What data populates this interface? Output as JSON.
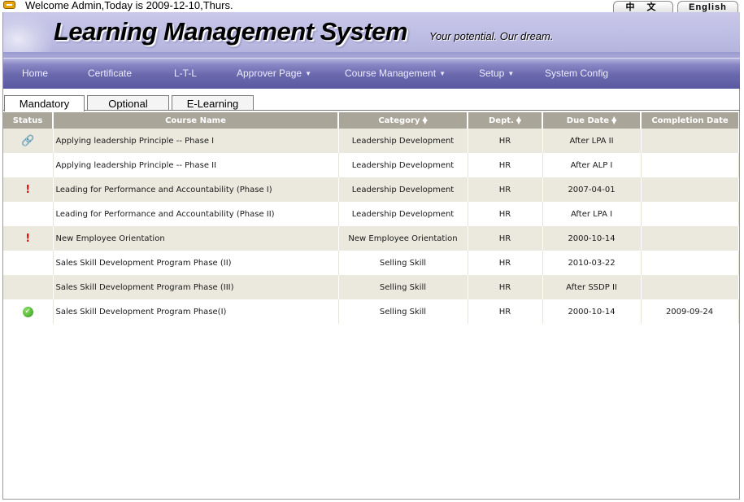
{
  "topbar": {
    "welcome_text": "Welcome Admin,Today is 2009-12-10,Thurs.",
    "lang_chinese": "中 文",
    "lang_english": "English"
  },
  "header": {
    "title": "Learning Management System",
    "tagline": "Your potential. Our dream."
  },
  "nav": {
    "items": [
      {
        "label": "Home",
        "has_dropdown": false
      },
      {
        "label": "Certificate",
        "has_dropdown": false
      },
      {
        "label": "L-T-L",
        "has_dropdown": false
      },
      {
        "label": "Approver Page",
        "has_dropdown": true
      },
      {
        "label": "Course Management",
        "has_dropdown": true
      },
      {
        "label": "Setup",
        "has_dropdown": true
      },
      {
        "label": "System Config",
        "has_dropdown": false
      }
    ],
    "caret": "▼"
  },
  "tabs": [
    {
      "label": "Mandatory",
      "active": true
    },
    {
      "label": "Optional",
      "active": false
    },
    {
      "label": "E-Learning",
      "active": false
    }
  ],
  "table": {
    "columns": [
      {
        "label": "Status",
        "sortable": false
      },
      {
        "label": "Course Name",
        "sortable": false
      },
      {
        "label": "Category",
        "sortable": true
      },
      {
        "label": "Dept.",
        "sortable": true
      },
      {
        "label": "Due Date",
        "sortable": true
      },
      {
        "label": "Completion Date",
        "sortable": false
      }
    ],
    "rows": [
      {
        "status": "link-icon",
        "course": "Applying leadership Principle -- Phase I",
        "category": "Leadership Development",
        "dept": "HR",
        "due": "After LPA II",
        "completion": ""
      },
      {
        "status": "",
        "course": "Applying leadership Principle -- Phase II",
        "category": "Leadership Development",
        "dept": "HR",
        "due": "After ALP I",
        "completion": ""
      },
      {
        "status": "warning-icon",
        "course": "Leading for Performance and Accountability (Phase I)",
        "category": "Leadership Development",
        "dept": "HR",
        "due": "2007-04-01",
        "completion": ""
      },
      {
        "status": "",
        "course": "Leading for Performance and Accountability (Phase II)",
        "category": "Leadership Development",
        "dept": "HR",
        "due": "After LPA I",
        "completion": ""
      },
      {
        "status": "warning-icon",
        "course": "New Employee Orientation",
        "category": "New Employee Orientation",
        "dept": "HR",
        "due": "2000-10-14",
        "completion": ""
      },
      {
        "status": "",
        "course": "Sales Skill Development Program Phase (II)",
        "category": "Selling Skill",
        "dept": "HR",
        "due": "2010-03-22",
        "completion": ""
      },
      {
        "status": "",
        "course": "Sales Skill Development Program Phase (III)",
        "category": "Selling Skill",
        "dept": "HR",
        "due": "After SSDP II",
        "completion": ""
      },
      {
        "status": "check-icon",
        "course": "Sales Skill Development Program Phase(I)",
        "category": "Selling Skill",
        "dept": "HR",
        "due": "2000-10-14",
        "completion": "2009-09-24"
      }
    ]
  },
  "colors": {
    "header_bg": "#c5c4e7",
    "nav_bg": "#6a68ad",
    "table_header_bg": "#a9a599",
    "row_alt_bg": "#ebe8dd",
    "warning": "#e01010",
    "ok": "#2e9a16"
  }
}
